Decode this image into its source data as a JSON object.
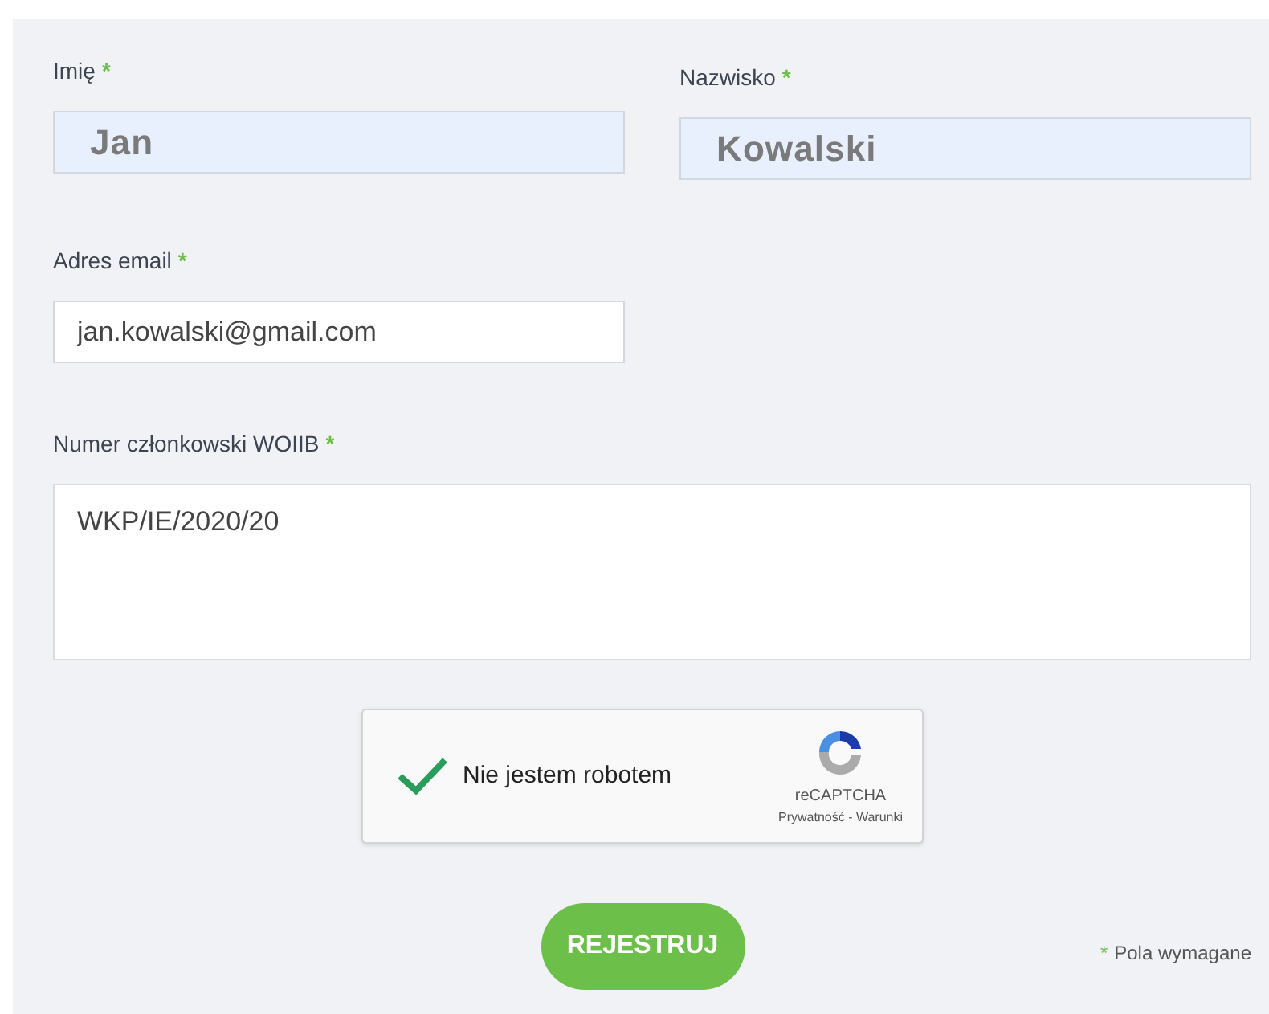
{
  "fields": [
    {
      "kind": "input",
      "label": "Imię",
      "required_mark": "*",
      "value": "Jan",
      "autofilled": true
    },
    {
      "kind": "input",
      "label": "Nazwisko",
      "required_mark": "*",
      "value": "Kowalski",
      "autofilled": true
    },
    {
      "kind": "input",
      "label": "Adres email",
      "required_mark": "*",
      "value": "jan.kowalski@gmail.com",
      "autofilled": false
    },
    {
      "kind": "textarea",
      "label": "Numer członkowski WOIIB",
      "required_mark": "*",
      "value": "WKP/IE/2020/20",
      "autofilled": false
    }
  ],
  "captcha": {
    "label": "Nie jestem robotem",
    "checked": true,
    "brand": "reCAPTCHA",
    "links": "Prywatność - Warunki"
  },
  "submit": {
    "label": "REJESTRUJ"
  },
  "footnote": {
    "mark": "*",
    "text": "Pola wymagane"
  }
}
